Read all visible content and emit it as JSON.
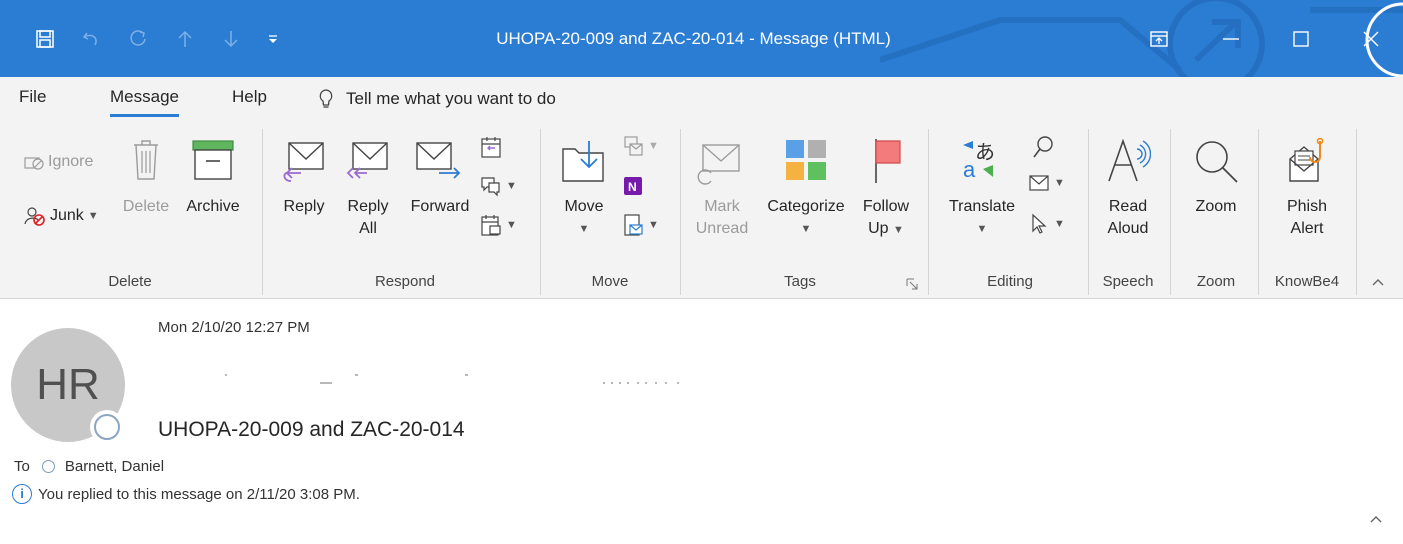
{
  "window": {
    "title": "UHOPA-20-009 and ZAC-20-014  -  Message (HTML)"
  },
  "tabs": [
    {
      "label": "File"
    },
    {
      "label": "Message",
      "active": true
    },
    {
      "label": "Help"
    }
  ],
  "tellme": {
    "label": "Tell me what you want to do"
  },
  "ribbon": {
    "delete": {
      "group_label": "Delete",
      "ignore": "Ignore",
      "junk": "Junk",
      "delete": "Delete",
      "archive": "Archive"
    },
    "respond": {
      "group_label": "Respond",
      "reply": "Reply",
      "reply_all_1": "Reply",
      "reply_all_2": "All",
      "forward": "Forward"
    },
    "move": {
      "group_label": "Move",
      "move": "Move"
    },
    "tags": {
      "group_label": "Tags",
      "mark_unread_1": "Mark",
      "mark_unread_2": "Unread",
      "categorize": "Categorize",
      "follow_up_1": "Follow",
      "follow_up_2": "Up"
    },
    "editing": {
      "group_label": "Editing",
      "translate": "Translate"
    },
    "speech": {
      "group_label": "Speech",
      "read_aloud_1": "Read",
      "read_aloud_2": "Aloud"
    },
    "zoom": {
      "group_label": "Zoom",
      "zoom": "Zoom"
    },
    "knowbe4": {
      "group_label": "KnowBe4",
      "phish_alert_1": "Phish",
      "phish_alert_2": "Alert"
    }
  },
  "message": {
    "avatar_initials": "HR",
    "date": "Mon 2/10/20 12:27 PM",
    "subject": "UHOPA-20-009 and ZAC-20-014",
    "to_label": "To",
    "to_name": "Barnett, Daniel",
    "info": "You replied to this message on 2/11/20 3:08 PM."
  },
  "colors": {
    "titlebar": "#2b7cd3",
    "ribbon": "#f3f3f3",
    "flag": "#f47b7b",
    "onenote": "#7719aa"
  }
}
